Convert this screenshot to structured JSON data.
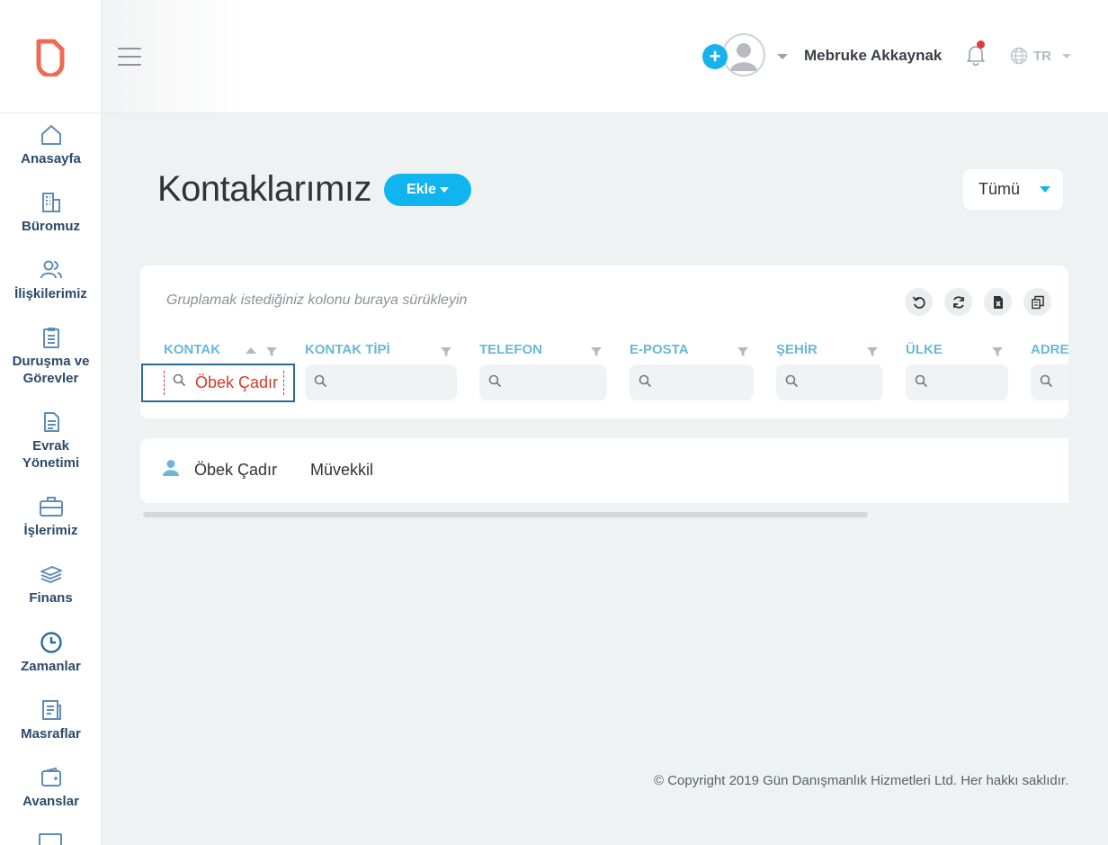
{
  "sidebar": {
    "items": [
      {
        "label": "Anasayfa",
        "icon": "home-icon"
      },
      {
        "label": "Büromuz",
        "icon": "building-icon"
      },
      {
        "label": "İlişkilerimiz",
        "icon": "users-icon"
      },
      {
        "label": "Duruşma ve Görevler",
        "icon": "clipboard-icon"
      },
      {
        "label": "Evrak Yönetimi",
        "icon": "document-icon"
      },
      {
        "label": "İşlerimiz",
        "icon": "briefcase-icon"
      },
      {
        "label": "Finans",
        "icon": "money-stack-icon"
      },
      {
        "label": "Zamanlar",
        "icon": "clock-icon"
      },
      {
        "label": "Masraflar",
        "icon": "receipt-icon"
      },
      {
        "label": "Avanslar",
        "icon": "wallet-icon"
      }
    ]
  },
  "header": {
    "add_symbol": "+",
    "username": "Mebruke Akkaynak",
    "language": "TR"
  },
  "page": {
    "title": "Kontaklarımız",
    "add_button": "Ekle",
    "scope_filter": "Tümü"
  },
  "grid": {
    "group_hint": "Gruplamak istediğiniz kolonu buraya sürükleyin",
    "toolbar": [
      "reset-icon",
      "refresh-icon",
      "excel-export-icon",
      "column-chooser-icon"
    ],
    "columns": [
      {
        "label": "KONTAK",
        "filter_value": "Öbek Çadır"
      },
      {
        "label": "KONTAK TİPİ",
        "filter_value": ""
      },
      {
        "label": "TELEFON",
        "filter_value": ""
      },
      {
        "label": "E-POSTA",
        "filter_value": ""
      },
      {
        "label": "ŞEHİR",
        "filter_value": ""
      },
      {
        "label": "ÜLKE",
        "filter_value": ""
      },
      {
        "label": "ADRES",
        "filter_value": ""
      }
    ],
    "rows": [
      {
        "name": "Öbek Çadır",
        "type": "Müvekkil"
      }
    ]
  },
  "footer": {
    "copyright": "© Copyright 2019 Gün Danışmanlık Hizmetleri Ltd. Her hakkı saklıdır."
  },
  "colors": {
    "accent": "#10b5ef",
    "nav_text": "#2b4a6a",
    "logo": "#ef6a54",
    "column_header": "#6ab8d6"
  }
}
